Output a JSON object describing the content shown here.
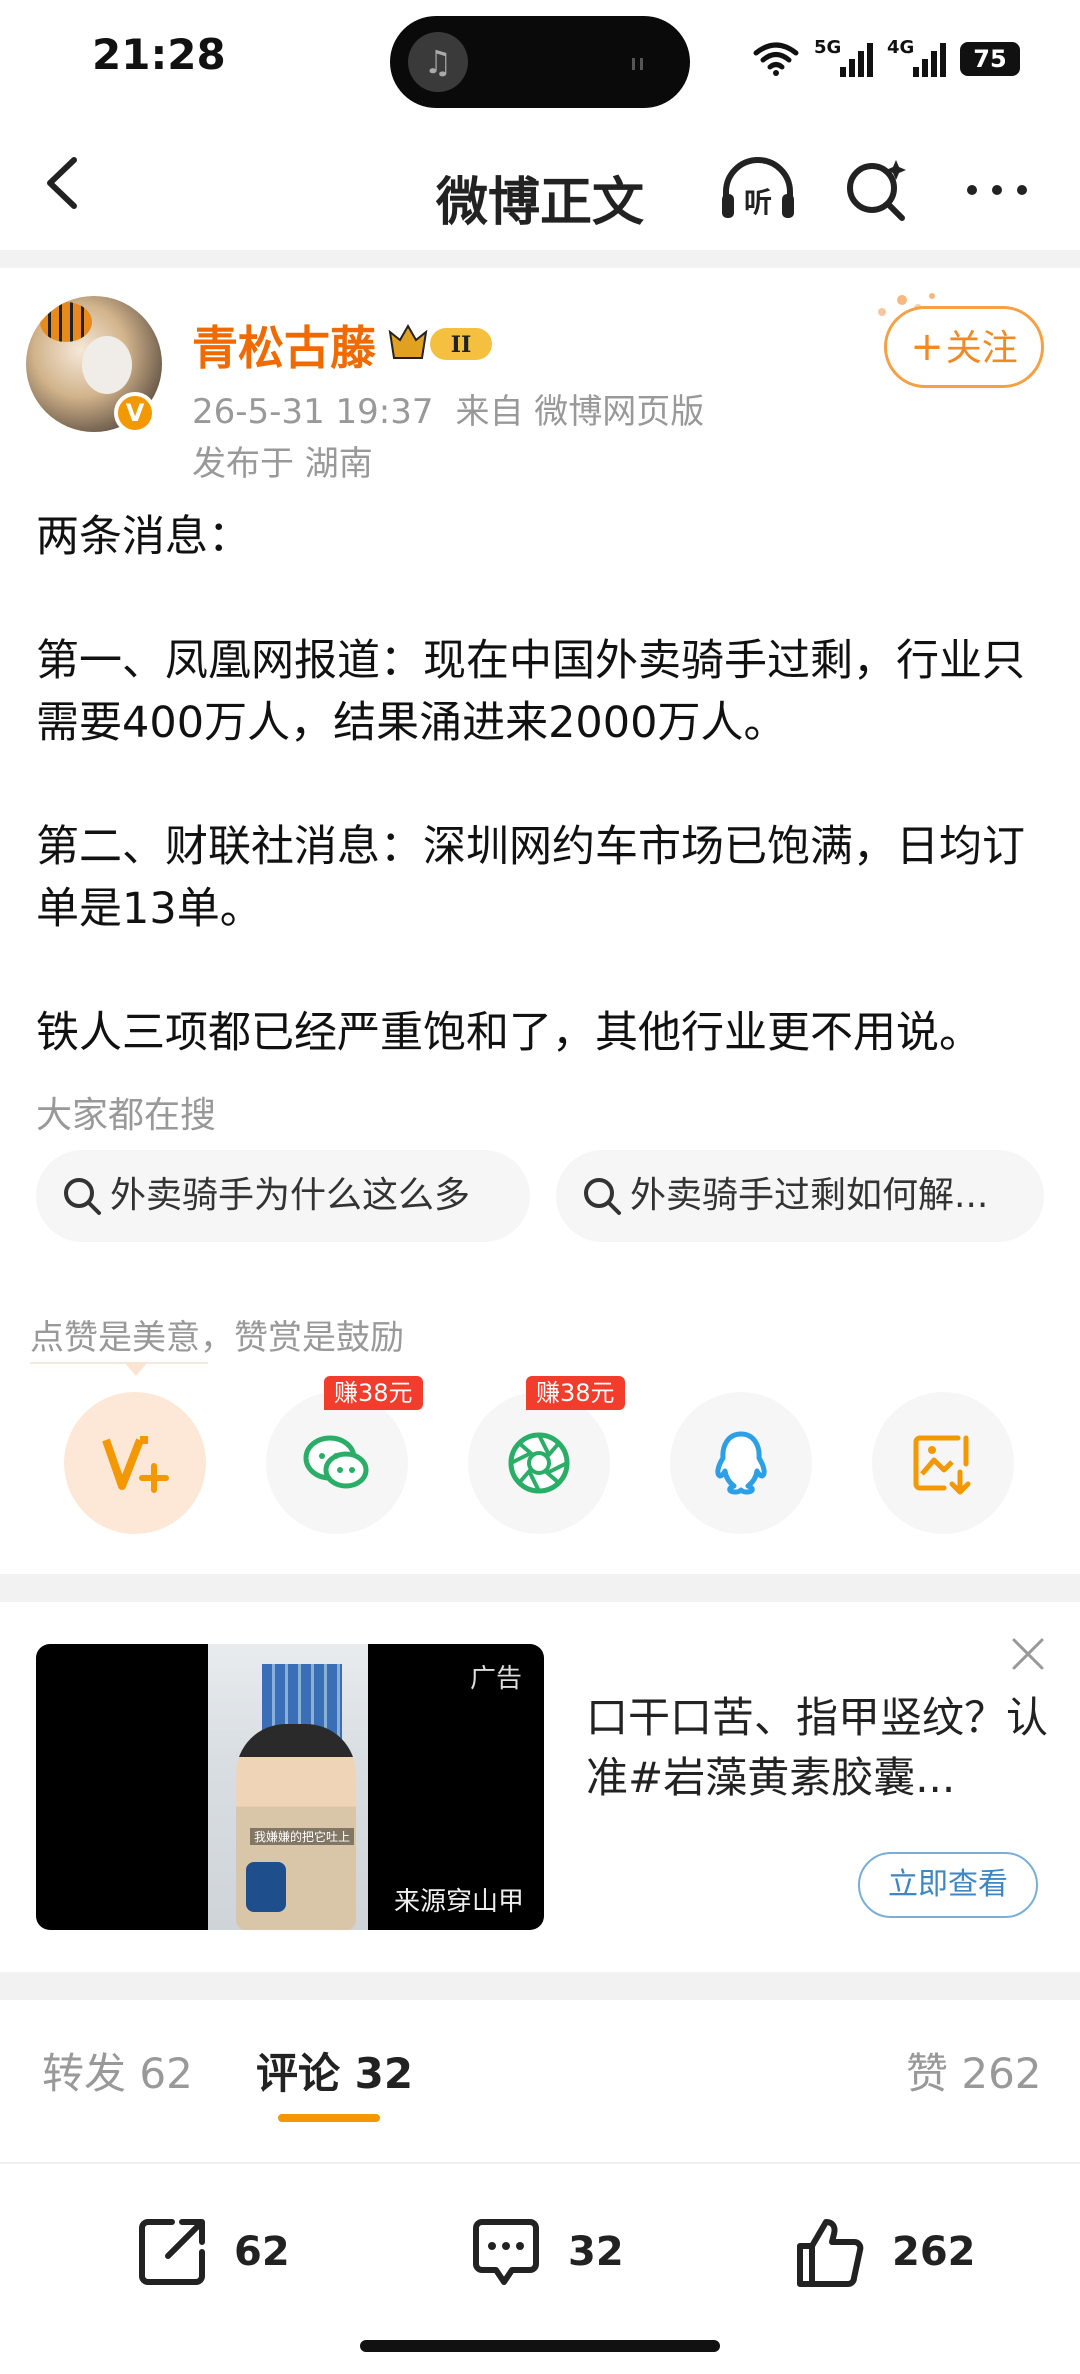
{
  "status_bar": {
    "time": "21:28",
    "net1": "5G",
    "net2": "4G",
    "battery": "75"
  },
  "nav": {
    "title": "微博正文",
    "listen_label": "听"
  },
  "author": {
    "name": "青松古藤",
    "level_badge": "II",
    "verified_mark": "V",
    "timestamp": "26-5-31 19:37",
    "source": "来自 微博网页版",
    "location": "发布于 湖南",
    "follow_label": "关注"
  },
  "post": {
    "paragraphs": [
      "两条消息：",
      "",
      "第一、凤凰网报道：现在中国外卖骑手过剩，行业只需要400万人，结果涌进来2000万人。",
      "",
      "第二、财联社消息：深圳网约车市场已饱满，日均订单是13单。",
      "",
      "铁人三项都已经严重饱和了，其他行业更不用说。"
    ]
  },
  "hot_search": {
    "title": "大家都在搜",
    "chips": [
      "外卖骑手为什么这么多",
      "外卖骑手过剩如何解..."
    ]
  },
  "reward": {
    "tip": "点赞是美意，赞赏是鼓励",
    "wechat_earn": "赚38元",
    "moments_earn": "赚38元"
  },
  "ad": {
    "tag": "广告",
    "source": "来源穿山甲",
    "caption": "我嫌嫌的把它吐上",
    "title": "口干口苦、指甲竖纹？认准#岩藻黄素胶囊...",
    "button": "立即查看"
  },
  "tabs": {
    "repost": "转发 62",
    "comment": "评论 32",
    "like": "赞 262"
  },
  "bottom_bar": {
    "repost_count": "62",
    "comment_count": "32",
    "like_count": "262"
  },
  "colors": {
    "accent": "#f39800",
    "username": "#f06a00",
    "ad_button": "#3e86c4",
    "earn_badge": "#f23c2c"
  }
}
